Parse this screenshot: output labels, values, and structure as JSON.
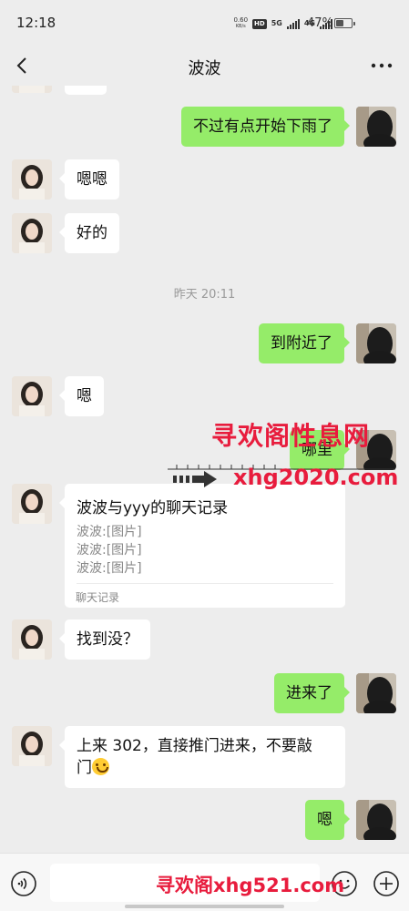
{
  "status_bar": {
    "time": "12:18",
    "net_speed_value": "0.60",
    "net_speed_unit": "KB/s",
    "hd_badge": "HD",
    "network_a": "5G",
    "network_b": "4G",
    "battery_percent": "47%",
    "battery_level": 0.47
  },
  "nav": {
    "title": "波波",
    "back_icon": "chevron-left-icon",
    "more_icon": "more-dots-icon"
  },
  "messages": {
    "m0": {
      "sender": "me",
      "text": "不过有点开始下雨了"
    },
    "m1": {
      "sender": "other",
      "text": "嗯嗯"
    },
    "m2": {
      "sender": "other",
      "text": "好的"
    },
    "ts1": "昨天 20:11",
    "m3": {
      "sender": "me",
      "text": "到附近了"
    },
    "m4": {
      "sender": "other",
      "text": "嗯"
    },
    "m5": {
      "sender": "me",
      "text": "哪里"
    },
    "m6": {
      "sender": "other",
      "type": "chat-record",
      "title": "波波与yyy的聊天记录",
      "lines": [
        "波波:[图片]",
        "波波:[图片]",
        "波波:[图片]"
      ],
      "footer": "聊天记录"
    },
    "m7": {
      "sender": "other",
      "text": "找到没？"
    },
    "m8": {
      "sender": "me",
      "text": "进来了"
    },
    "m9": {
      "sender": "other",
      "text": "上来 302，直接推门进来，不要敲门",
      "emoji": "smiling-sweat-emoji"
    },
    "m10": {
      "sender": "me",
      "text": "嗯"
    }
  },
  "watermark": {
    "title": "寻欢阁性息网",
    "domain": "xhg2020.com",
    "bottom": "寻欢阁xhg521.com"
  },
  "input_bar": {
    "voice_icon": "voice-icon",
    "text_value": "",
    "emoji_icon": "emoji-icon",
    "plus_icon": "plus-icon"
  },
  "colors": {
    "background": "#ededed",
    "bubble_me": "#95ec69",
    "bubble_other": "#ffffff",
    "watermark": "#e81c3d"
  }
}
